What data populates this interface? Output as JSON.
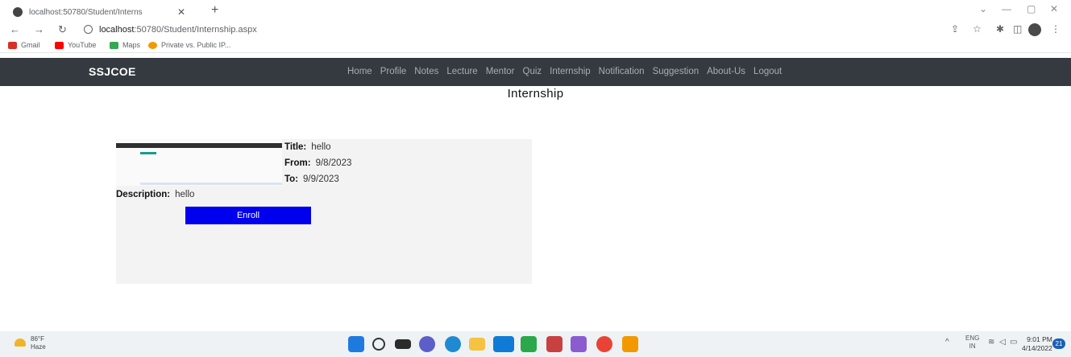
{
  "browser": {
    "tab_title": "localhost:50780/Student/Interns",
    "url_host": "localhost",
    "url_rest": ":50780/Student/Internship.aspx",
    "bookmarks": [
      {
        "label": "Gmail",
        "color": "#d93025"
      },
      {
        "label": "YouTube",
        "color": "#ff0000"
      },
      {
        "label": "Maps",
        "color": "#34a853"
      },
      {
        "label": "Private vs. Public IP...",
        "color": "#f29900"
      }
    ]
  },
  "navbar": {
    "brand": "SSJCOE",
    "links": [
      "Home",
      "Profile",
      "Notes",
      "Lecture",
      "Mentor",
      "Quiz",
      "Internship",
      "Notification",
      "Suggestion",
      "About-Us",
      "Logout"
    ]
  },
  "page": {
    "title": "Internship"
  },
  "internship": {
    "title_label": "Title:",
    "title_value": "hello",
    "from_label": "From:",
    "from_value": "9/8/2023",
    "to_label": "To:",
    "to_value": "9/9/2023",
    "description_label": "Description:",
    "description_value": "hello",
    "enroll_label": "Enroll"
  },
  "taskbar": {
    "temperature": "86°F",
    "condition": "Haze",
    "language": "ENG",
    "region": "IN",
    "time": "9:01 PM",
    "date": "4/14/2022",
    "notifications": "21"
  }
}
